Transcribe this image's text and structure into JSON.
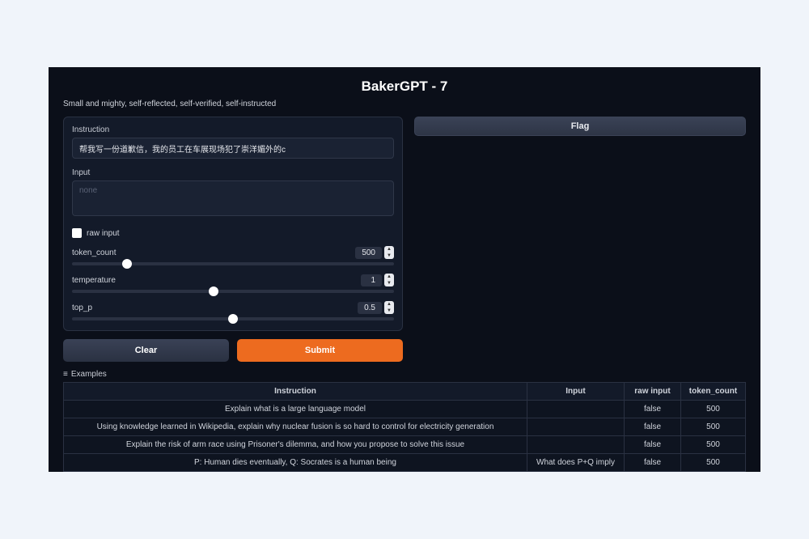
{
  "title": "BakerGPT - 7",
  "subtitle": "Small and mighty, self-reflected, self-verified, self-instructed",
  "form": {
    "instruction_label": "Instruction",
    "instruction_value": "帮我写一份道歉信，我的员工在车展现场犯了崇洋媚外的c",
    "input_label": "Input",
    "input_placeholder": "none",
    "raw_input_label": "raw input",
    "sliders": {
      "token_count": {
        "label": "token_count",
        "value": "500",
        "pos": 17
      },
      "temperature": {
        "label": "temperature",
        "value": "1",
        "pos": 44
      },
      "top_p": {
        "label": "top_p",
        "value": "0.5",
        "pos": 50
      }
    },
    "clear_label": "Clear",
    "submit_label": "Submit"
  },
  "flag_label": "Flag",
  "examples_label": "Examples",
  "table": {
    "headers": {
      "instruction": "Instruction",
      "input": "Input",
      "raw_input": "raw input",
      "token_count": "token_count"
    },
    "rows": [
      {
        "instruction": "Explain what is a large language model",
        "input": "",
        "raw_input": "false",
        "token_count": "500"
      },
      {
        "instruction": "Using knowledge learned in Wikipedia, explain why nuclear fusion is so hard to control for electricity generation",
        "input": "",
        "raw_input": "false",
        "token_count": "500"
      },
      {
        "instruction": "Explain the risk of arm race using Prisoner's dilemma, and how you propose to solve this issue",
        "input": "",
        "raw_input": "false",
        "token_count": "500"
      },
      {
        "instruction": "P: Human dies eventually, Q: Socrates is a human being",
        "input": "What does P+Q imply",
        "raw_input": "false",
        "token_count": "500"
      }
    ]
  }
}
